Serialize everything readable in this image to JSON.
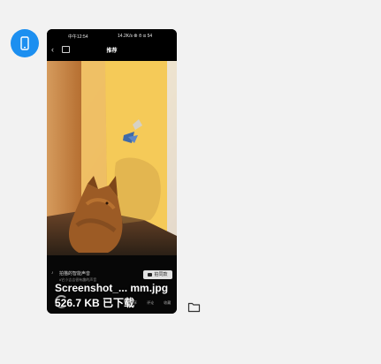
{
  "message": {
    "file_name": "Screenshot_... mm.jpg",
    "file_size_status": "526.7 KB 已下载"
  },
  "phone": {
    "status_time": "中午12:54",
    "status_right": "14.2K/s ⦾ ⊛ ⊡ 54",
    "nav_title": "推荐",
    "sound_title": "拍猫的智能声音",
    "sound_subtitle": "#它小吉吉很有趣的声音",
    "same_button": "拍同款",
    "tools": [
      "分享",
      "评论",
      "收藏"
    ]
  },
  "icons": {
    "avatar": "phone-icon",
    "folder": "folder-icon",
    "back": "chevron-left-icon",
    "share": "share-icon",
    "music": "music-note-icon",
    "camera": "camera-icon"
  },
  "colors": {
    "background": "#f2f2f2",
    "avatar": "#1c8ff0",
    "photo_light": "#f0c84e",
    "photo_wall": "#b97c3e",
    "cat": "#9a5c24"
  }
}
